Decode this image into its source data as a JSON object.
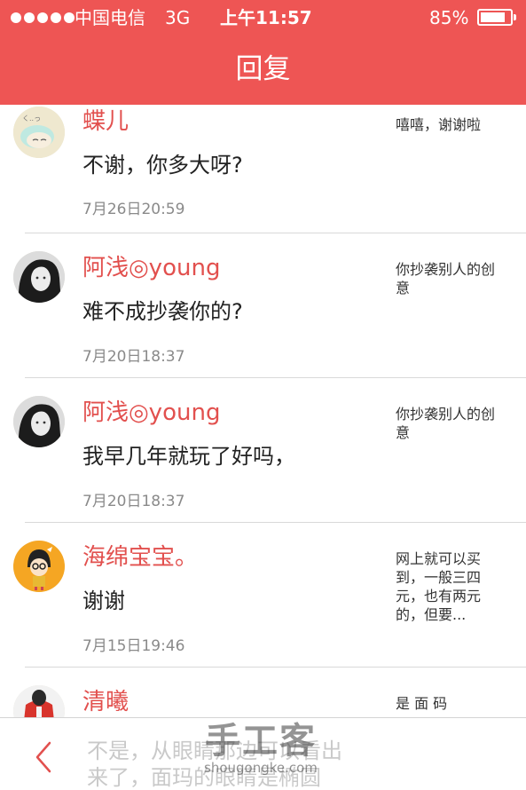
{
  "status_bar": {
    "carrier": "中国电信",
    "network": "3G",
    "time": "上午11:57",
    "battery": "85%",
    "battery_level": 0.85
  },
  "header": {
    "title": "回复"
  },
  "replies": [
    {
      "name": "蝶儿",
      "message": "不谢，你多大呀?",
      "time": "7月26日20:59",
      "quote": "嘻嘻，谢谢啦",
      "avatar_icon": "anime-sleeping-avatar"
    },
    {
      "name": "阿浅◎young",
      "message": "难不成抄袭你的?",
      "time": "7月20日18:37",
      "quote": "你抄袭别人的创意",
      "avatar_icon": "girl-photo-avatar"
    },
    {
      "name": "阿浅◎young",
      "message": "我早几年就玩了好吗，",
      "time": "7月20日18:37",
      "quote": "你抄袭别人的创意",
      "avatar_icon": "girl-photo-avatar"
    },
    {
      "name": "海绵宝宝。",
      "message": "谢谢",
      "time": "7月15日19:46",
      "quote": "网上就可以买到，一般三四元，也有两元的，但要...",
      "avatar_icon": "cartoon-girl-avatar"
    },
    {
      "name": "清曦",
      "message": "",
      "time": "",
      "quote": "是 面 码",
      "avatar_icon": "red-coat-avatar"
    }
  ],
  "bottom_bar": {
    "back_icon": "chevron-left-icon",
    "text_line1": "不是，从眼睛那边可以看出",
    "text_line2": "来了，面玛的眼睛是椭圆"
  },
  "watermark": {
    "main": "手工客",
    "sub": "shougongke.com"
  },
  "colors": {
    "accent": "#ee5554",
    "name": "#e2504e",
    "time": "#8a8a8a"
  }
}
